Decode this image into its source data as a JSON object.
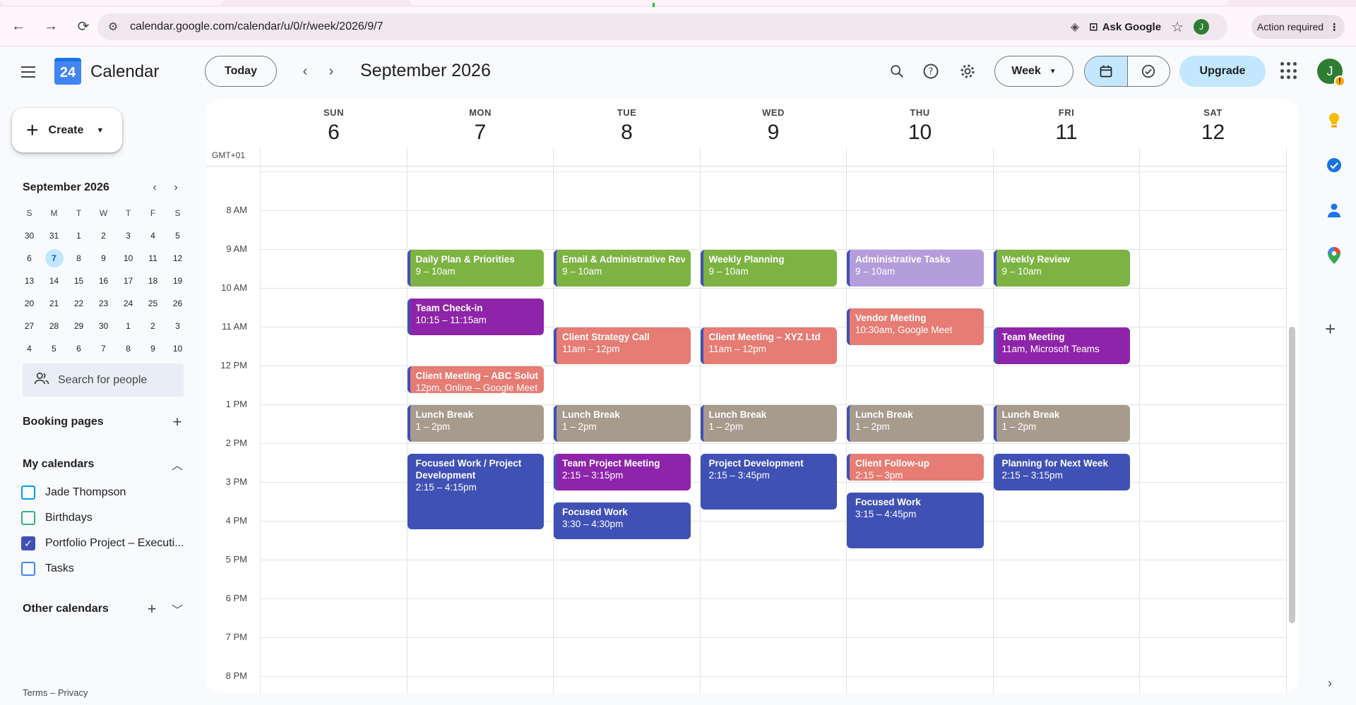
{
  "browser": {
    "url": "calendar.google.com/calendar/u/0/r/week/2026/9/7",
    "ask_google": "Ask Google",
    "profile_initial": "J",
    "action_required": "Action required"
  },
  "header": {
    "app_name": "Calendar",
    "logo_day": "24",
    "today_label": "Today",
    "month_title": "September 2026",
    "view_label": "Week",
    "upgrade_label": "Upgrade",
    "avatar_initial": "J"
  },
  "sidebar": {
    "create_label": "Create",
    "mini_calendar": {
      "title": "September 2026",
      "weekdays": [
        "S",
        "M",
        "T",
        "W",
        "T",
        "F",
        "S"
      ],
      "weeks": [
        [
          "30",
          "31",
          "1",
          "2",
          "3",
          "4",
          "5"
        ],
        [
          "6",
          "7",
          "8",
          "9",
          "10",
          "11",
          "12"
        ],
        [
          "13",
          "14",
          "15",
          "16",
          "17",
          "18",
          "19"
        ],
        [
          "20",
          "21",
          "22",
          "23",
          "24",
          "25",
          "26"
        ],
        [
          "27",
          "28",
          "29",
          "30",
          "1",
          "2",
          "3"
        ],
        [
          "4",
          "5",
          "6",
          "7",
          "8",
          "9",
          "10"
        ]
      ],
      "selected": "7"
    },
    "people_search_placeholder": "Search for people",
    "booking_pages": "Booking pages",
    "my_calendars": "My calendars",
    "calendars": [
      {
        "name": "Jade Thompson",
        "checked": false,
        "color": "#039be5"
      },
      {
        "name": "Birthdays",
        "checked": false,
        "color": "#33b679"
      },
      {
        "name": "Portfolio Project – Executi...",
        "checked": true,
        "color": "#3f51b5"
      },
      {
        "name": "Tasks",
        "checked": false,
        "color": "#4285f4"
      }
    ],
    "other_calendars": "Other calendars",
    "footer": "Terms – Privacy"
  },
  "week": {
    "timezone": "GMT+01",
    "days": [
      {
        "dow": "SUN",
        "num": "6"
      },
      {
        "dow": "MON",
        "num": "7"
      },
      {
        "dow": "TUE",
        "num": "8"
      },
      {
        "dow": "WED",
        "num": "9"
      },
      {
        "dow": "THU",
        "num": "10"
      },
      {
        "dow": "FRI",
        "num": "11"
      },
      {
        "dow": "SAT",
        "num": "12"
      }
    ],
    "hours": [
      "8 AM",
      "9 AM",
      "10 AM",
      "11 AM",
      "12 PM",
      "1 PM",
      "2 PM",
      "3 PM",
      "4 PM",
      "5 PM",
      "6 PM",
      "7 PM",
      "8 PM"
    ],
    "events": [
      {
        "day": 1,
        "start": 9,
        "end": 10,
        "title": "Daily Plan & Priorities",
        "time": "9 – 10am",
        "color": "#7cb342"
      },
      {
        "day": 1,
        "start": 10.25,
        "end": 11.25,
        "title": "Team Check-in",
        "time": "10:15 – 11:15am",
        "color": "#8e24aa"
      },
      {
        "day": 1,
        "start": 12,
        "end": 12.75,
        "title": "Client Meeting – ABC Solutions",
        "time": "12pm, Online – Google Meet",
        "color": "#e67c73"
      },
      {
        "day": 1,
        "start": 13,
        "end": 14,
        "title": "Lunch Break",
        "time": "1 – 2pm",
        "color": "#a79b8e"
      },
      {
        "day": 1,
        "start": 14.25,
        "end": 16.25,
        "title": "Focused Work / Project Development",
        "time": "2:15 – 4:15pm",
        "color": "#3f51b5",
        "wrap": true
      },
      {
        "day": 2,
        "start": 9,
        "end": 10,
        "title": "Email & Administrative Review",
        "time": "9 – 10am",
        "color": "#7cb342"
      },
      {
        "day": 2,
        "start": 11,
        "end": 12,
        "title": "Client Strategy Call",
        "time": "11am – 12pm",
        "color": "#e67c73"
      },
      {
        "day": 2,
        "start": 13,
        "end": 14,
        "title": "Lunch Break",
        "time": "1 – 2pm",
        "color": "#a79b8e"
      },
      {
        "day": 2,
        "start": 14.25,
        "end": 15.25,
        "title": "Team Project Meeting",
        "time": "2:15 – 3:15pm",
        "color": "#8e24aa"
      },
      {
        "day": 2,
        "start": 15.5,
        "end": 16.5,
        "title": "Focused Work",
        "time": "3:30 – 4:30pm",
        "color": "#3f51b5"
      },
      {
        "day": 3,
        "start": 9,
        "end": 10,
        "title": "Weekly Planning",
        "time": "9 – 10am",
        "color": "#7cb342"
      },
      {
        "day": 3,
        "start": 11,
        "end": 12,
        "title": "Client Meeting – XYZ Ltd",
        "time": "11am – 12pm",
        "color": "#e67c73"
      },
      {
        "day": 3,
        "start": 13,
        "end": 14,
        "title": "Lunch Break",
        "time": "1 – 2pm",
        "color": "#a79b8e"
      },
      {
        "day": 3,
        "start": 14.25,
        "end": 15.75,
        "title": "Project Development",
        "time": "2:15 – 3:45pm",
        "color": "#3f51b5"
      },
      {
        "day": 4,
        "start": 9,
        "end": 10,
        "title": "Administrative Tasks",
        "time": "9 – 10am",
        "color": "#b39ddb"
      },
      {
        "day": 4,
        "start": 10.5,
        "end": 11.5,
        "title": "Vendor Meeting",
        "time": "10:30am, Google Meet",
        "color": "#e67c73"
      },
      {
        "day": 4,
        "start": 13,
        "end": 14,
        "title": "Lunch Break",
        "time": "1 – 2pm",
        "color": "#a79b8e"
      },
      {
        "day": 4,
        "start": 14.25,
        "end": 15,
        "title": "Client Follow-up",
        "time": "2:15 – 3pm",
        "color": "#e67c73"
      },
      {
        "day": 4,
        "start": 15.25,
        "end": 16.75,
        "title": "Focused Work",
        "time": "3:15 – 4:45pm",
        "color": "#3f51b5"
      },
      {
        "day": 5,
        "start": 9,
        "end": 10,
        "title": "Weekly Review",
        "time": "9 – 10am",
        "color": "#7cb342"
      },
      {
        "day": 5,
        "start": 11,
        "end": 12,
        "title": "Team Meeting",
        "time": "11am, Microsoft Teams",
        "color": "#8e24aa"
      },
      {
        "day": 5,
        "start": 13,
        "end": 14,
        "title": "Lunch Break",
        "time": "1 – 2pm",
        "color": "#a79b8e"
      },
      {
        "day": 5,
        "start": 14.25,
        "end": 15.25,
        "title": "Planning for Next Week",
        "time": "2:15 – 3:15pm",
        "color": "#3f51b5"
      }
    ]
  }
}
